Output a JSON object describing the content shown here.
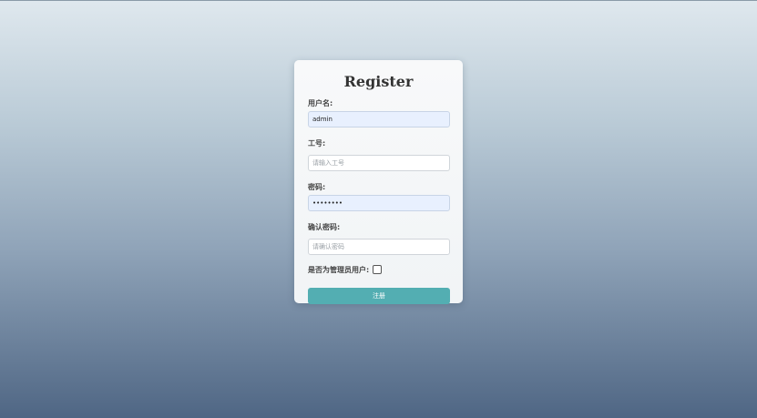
{
  "form": {
    "title": "Register",
    "username": {
      "label": "用户名:",
      "value": "admin",
      "placeholder": ""
    },
    "employee_id": {
      "label": "工号:",
      "value": "",
      "placeholder": "请输入工号"
    },
    "password": {
      "label": "密码:",
      "value": "••••••••",
      "placeholder": ""
    },
    "confirm_password": {
      "label": "确认密码:",
      "value": "",
      "placeholder": "请确认密码"
    },
    "is_admin": {
      "label": "是否为管理员用户:",
      "checked": false
    },
    "submit_label": "注册"
  },
  "colors": {
    "submit_button": "#53aeb2",
    "autofill_background": "#e8f0fe"
  }
}
